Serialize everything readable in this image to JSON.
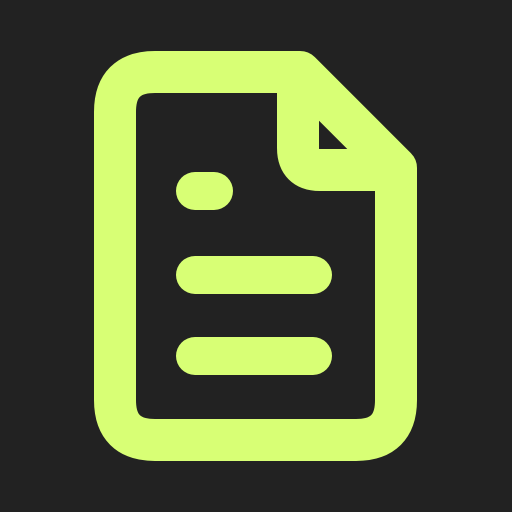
{
  "icon": {
    "name": "document-icon",
    "background_color": "#222222",
    "stroke_color": "#D8FF75"
  }
}
